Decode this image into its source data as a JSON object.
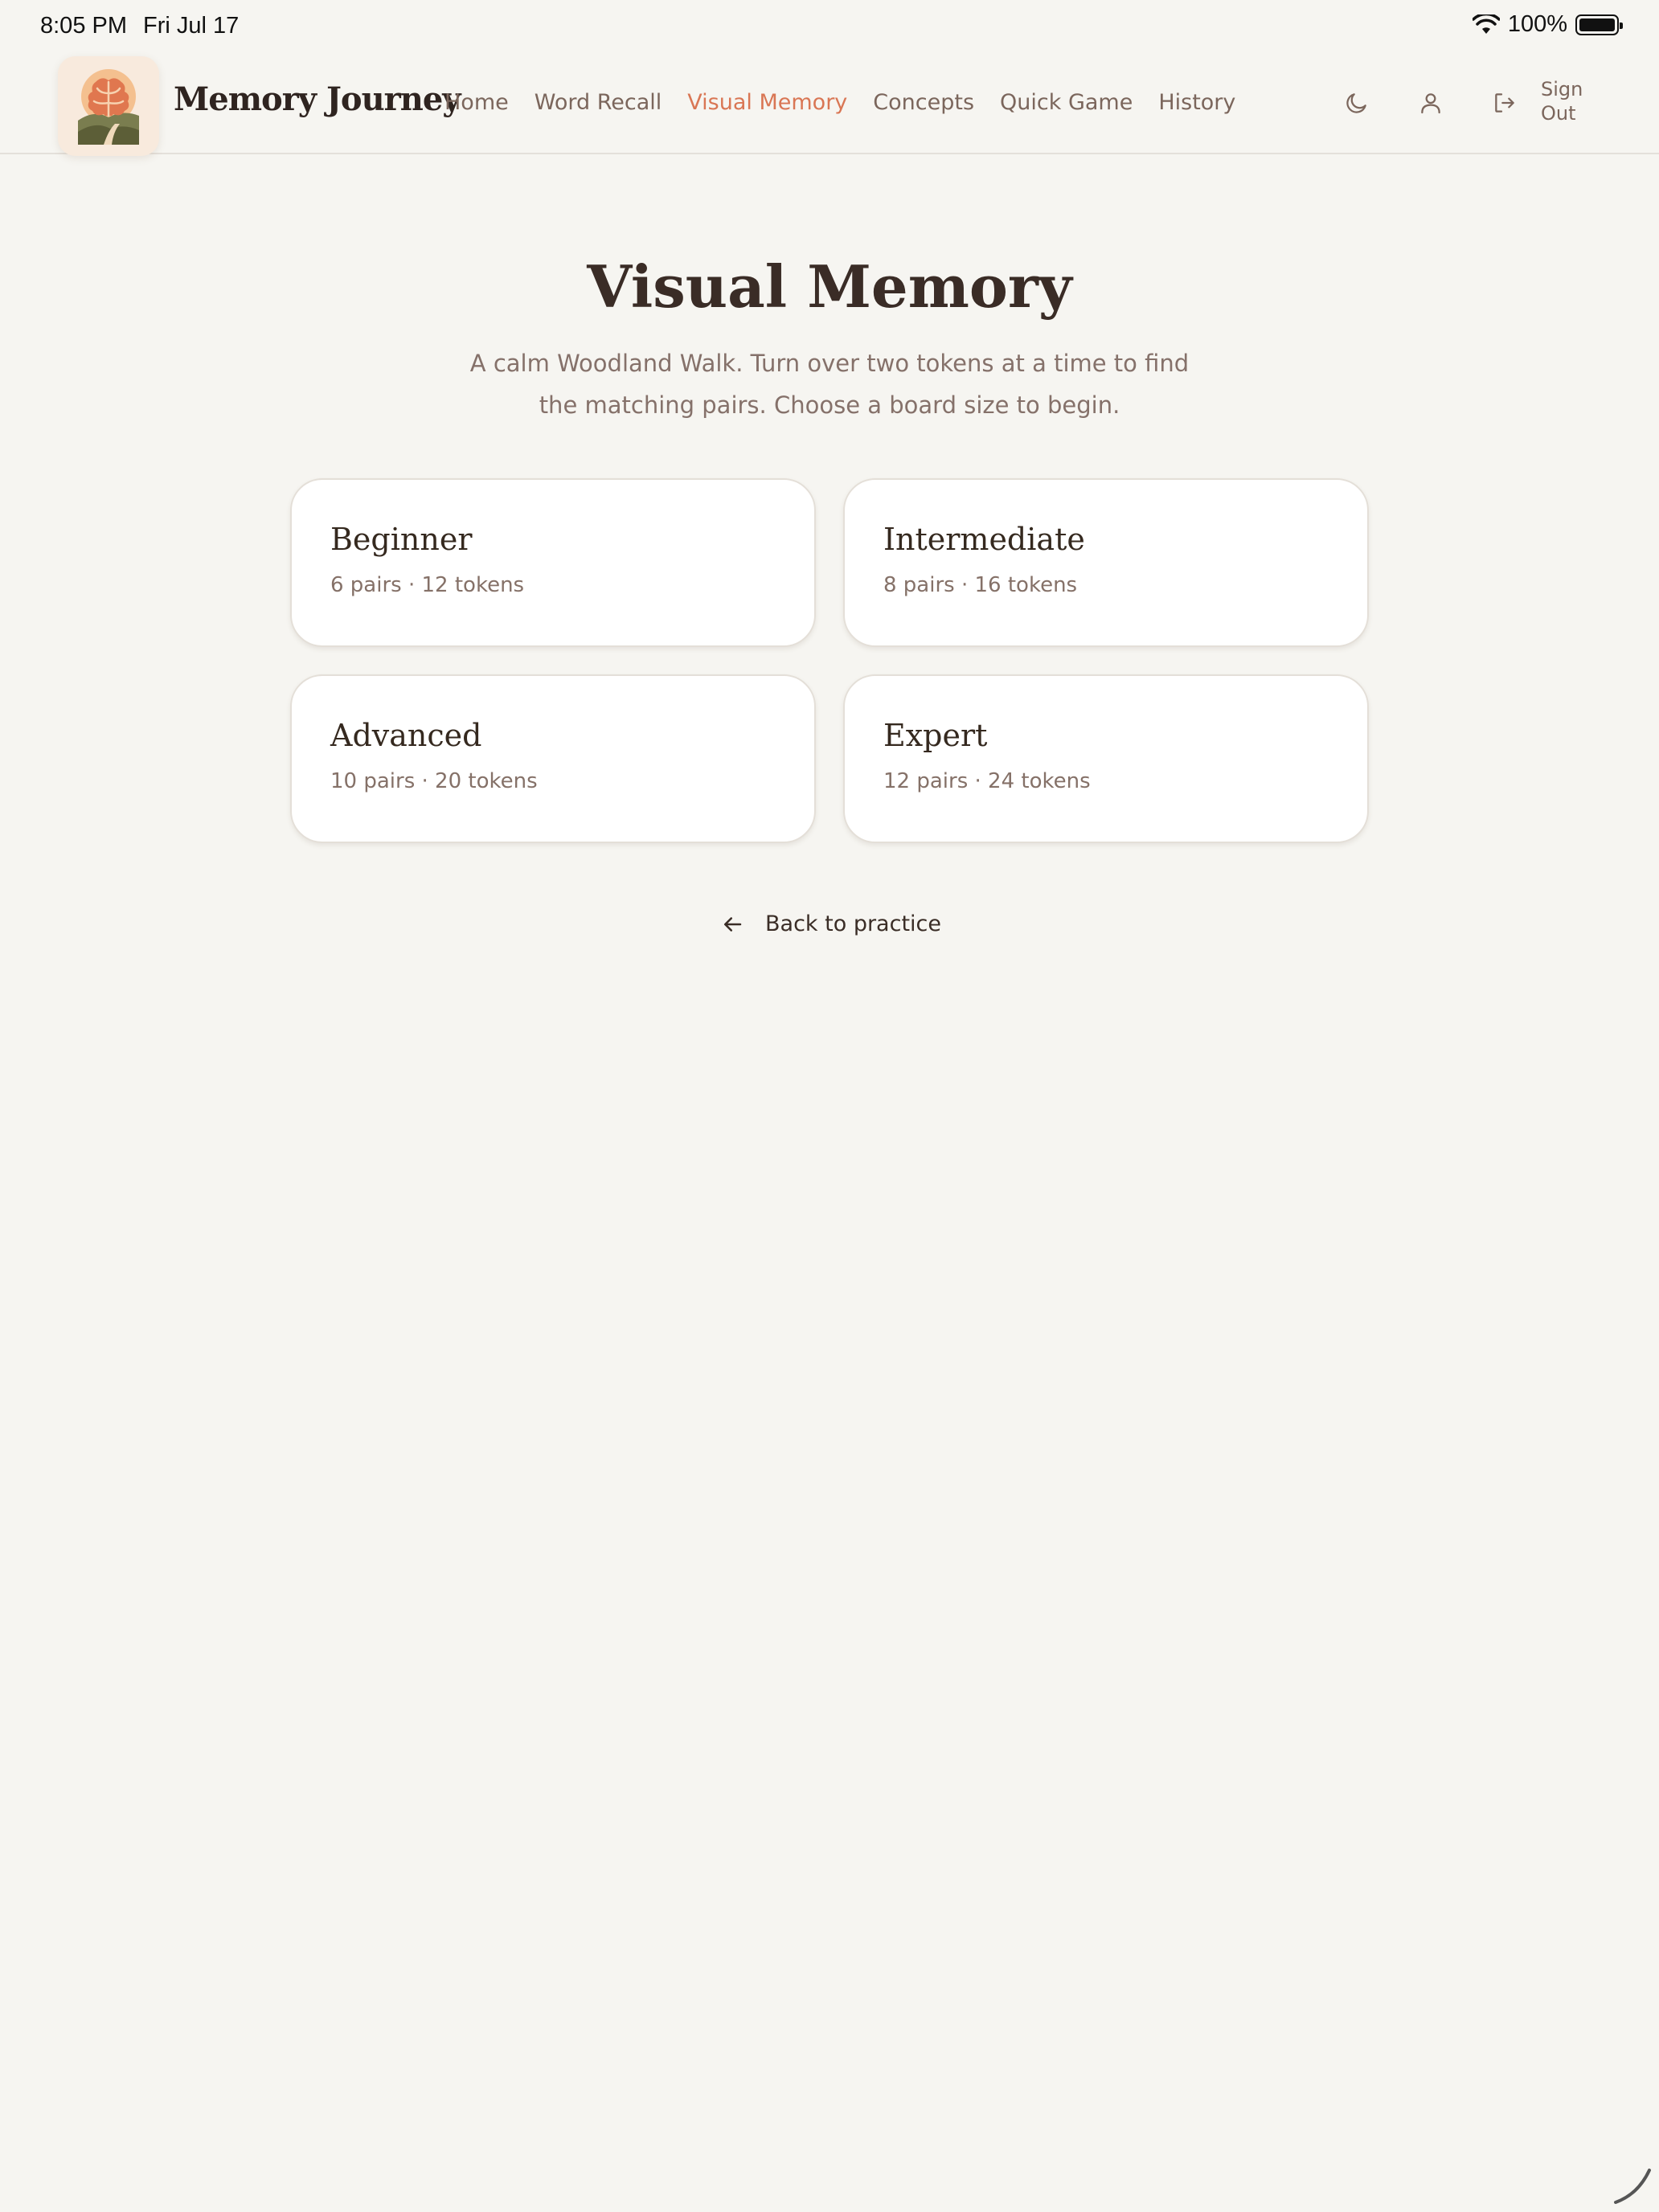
{
  "status_bar": {
    "time": "8:05 PM",
    "date": "Fri Jul 17",
    "battery": "100%"
  },
  "header": {
    "brand": "Memory Journey",
    "nav": [
      {
        "label": "Home",
        "active": false
      },
      {
        "label": "Word Recall",
        "active": false
      },
      {
        "label": "Visual Memory",
        "active": true
      },
      {
        "label": "Concepts",
        "active": false
      },
      {
        "label": "Quick Game",
        "active": false
      },
      {
        "label": "History",
        "active": false
      }
    ],
    "signout_line1": "Sign",
    "signout_line2": "Out",
    "accent_color": "#d97654"
  },
  "main": {
    "title": "Visual Memory",
    "subtitle_line1": "A calm Woodland Walk. Turn over two tokens at a time to find",
    "subtitle_line2": "the matching pairs. Choose a board size to begin.",
    "levels": [
      {
        "name": "Beginner",
        "detail": "6 pairs · 12 tokens"
      },
      {
        "name": "Intermediate",
        "detail": "8 pairs · 16 tokens"
      },
      {
        "name": "Advanced",
        "detail": "10 pairs · 20 tokens"
      },
      {
        "name": "Expert",
        "detail": "12 pairs · 24 tokens"
      }
    ],
    "back_label": "Back to practice"
  },
  "icons": [
    "wifi-icon",
    "battery-icon",
    "brain-logo-icon",
    "moon-icon",
    "user-icon",
    "sign-out-icon",
    "arrow-left-icon"
  ]
}
